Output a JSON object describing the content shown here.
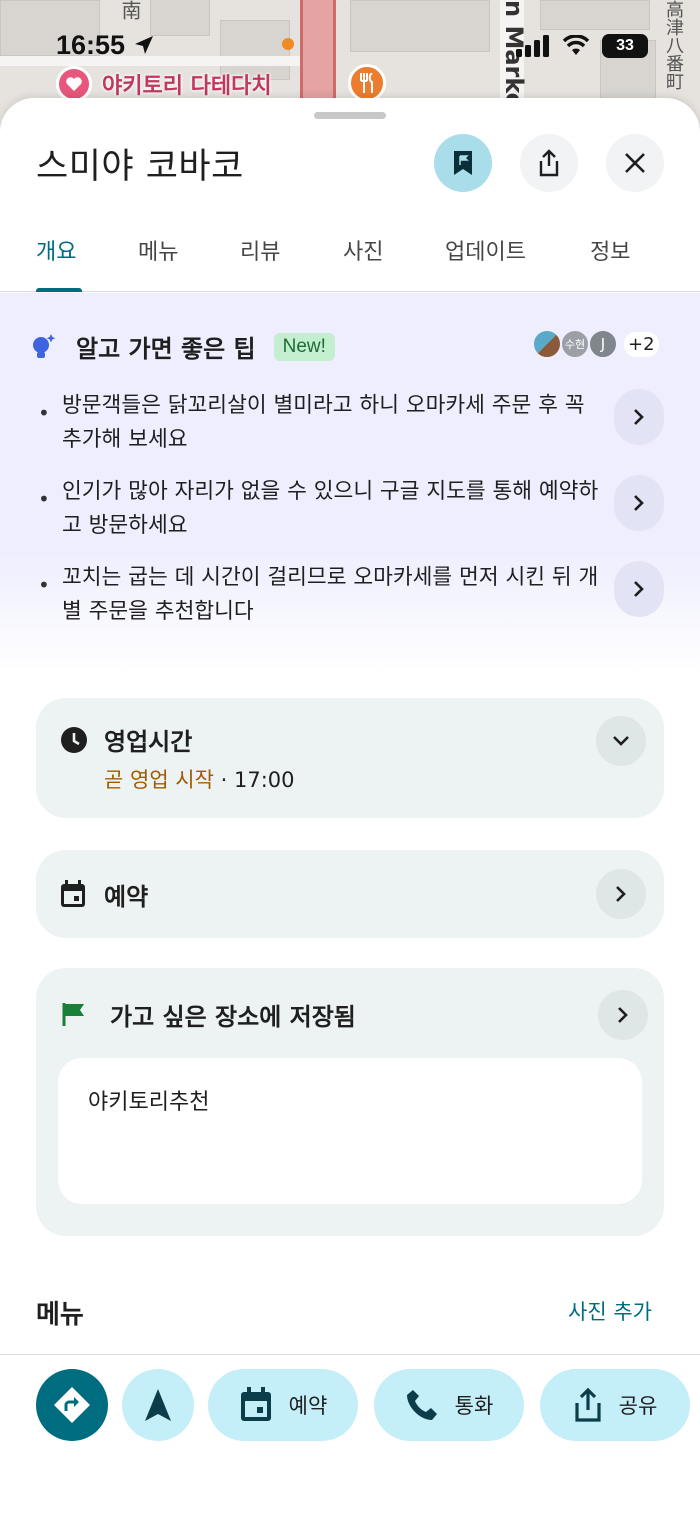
{
  "status_bar": {
    "time": "16:55",
    "battery": "33"
  },
  "map": {
    "poi_name": "야키토리 다테다치",
    "street_labels": [
      "南",
      "n Marke",
      "高津八番町"
    ]
  },
  "place": {
    "name": "스미야 코바코",
    "save_active_color": "#a9dde9"
  },
  "tabs": [
    {
      "label": "개요",
      "active": true
    },
    {
      "label": "메뉴",
      "active": false
    },
    {
      "label": "리뷰",
      "active": false
    },
    {
      "label": "사진",
      "active": false
    },
    {
      "label": "업데이트",
      "active": false
    },
    {
      "label": "정보",
      "active": false
    }
  ],
  "tips": {
    "title": "알고 가면 좋은 팁",
    "badge": "New!",
    "avatar_labels": [
      "수현",
      "J"
    ],
    "avatar_more": "+2",
    "items": [
      {
        "text": "방문객들은 닭꼬리살이 별미라고 하니 오마카세 주문 후 꼭 추가해 보세요"
      },
      {
        "text": "인기가 많아 자리가 없을 수 있으니 구글 지도를 통해 예약하고 방문하세요"
      },
      {
        "text": "꼬치는 굽는 데 시간이 걸리므로 오마카세를 먼저 시킨 뒤 개별 주문을 추천합니다"
      }
    ]
  },
  "hours": {
    "title": "영업시간",
    "status": "곧 영업 시작",
    "separator": " · ",
    "time": "17:00"
  },
  "reservation": {
    "title": "예약"
  },
  "saved": {
    "title": "가고 싶은 장소에 저장됨",
    "list_name": "야키토리추천"
  },
  "menu_section": {
    "title": "메뉴",
    "add_photo": "사진 추가"
  },
  "actions": {
    "reserve": "예약",
    "call": "통화",
    "share": "공유"
  },
  "colors": {
    "accent": "#006c7f",
    "hours_status": "#a15c00",
    "tips_bg": "#eeeefe",
    "card_bg": "#edf3f3",
    "action_bg": "#c4eef8"
  }
}
